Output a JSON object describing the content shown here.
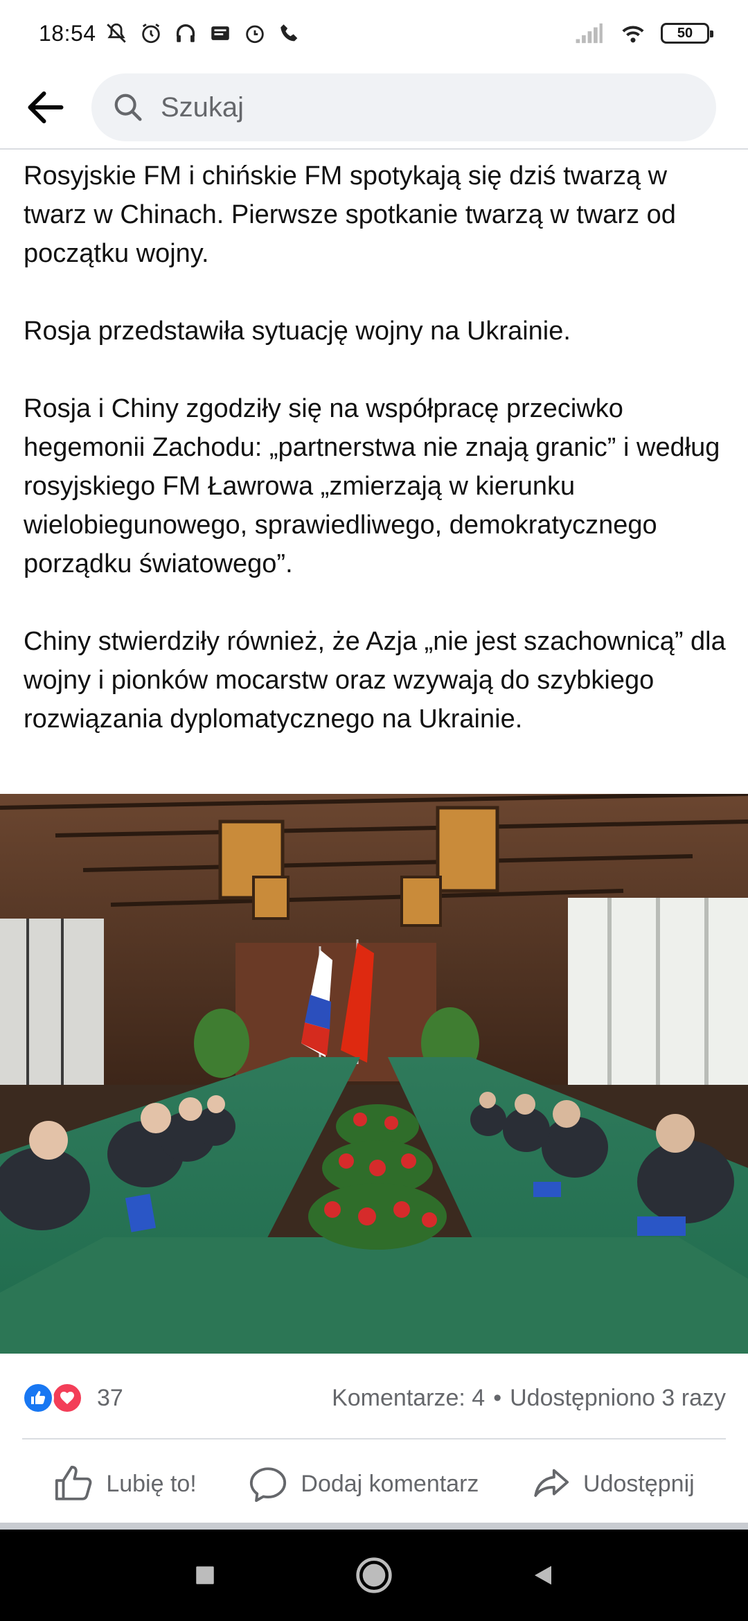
{
  "status_bar": {
    "time": "18:54",
    "battery": "50",
    "left_icons": [
      "mute-icon",
      "alarm-icon",
      "headset-icon",
      "message-icon",
      "alarm-clock-icon",
      "phone-icon"
    ],
    "right_icons": [
      "signal-icon",
      "wifi-icon",
      "battery-icon"
    ]
  },
  "top_nav": {
    "back_icon": "arrow-left-icon",
    "search_placeholder": "Szukaj"
  },
  "post": {
    "paragraphs": [
      "Rosyjskie FM i chińskie FM spotykają się dziś twarzą w twarz w Chinach. Pierwsze spotkanie twarzą w twarz od początku wojny.",
      "Rosja przedstawiła sytuację wojny na Ukrainie.",
      "Rosja i Chiny zgodziły się na współpracę przeciwko hegemonii Zachodu: „partnerstwa nie znają granic” i według rosyjskiego FM Ławrowa „zmierzają w kierunku wielobiegunowego, sprawiedliwego, demokratycznego porządku światowego”.",
      "Chiny stwierdziły również, że Azja „nie jest szachownicą” dla wojny i pionków mocarstw oraz wzywają do szybkiego rozwiązania dyplomatycznego na Ukrainie."
    ]
  },
  "reactions": {
    "count": "37",
    "comments": "Komentarze: 4",
    "separator": "•",
    "shares": "Udostępniono 3 razy"
  },
  "actions": {
    "like_label": "Lubię to!",
    "comment_label": "Dodaj komentarz",
    "share_label": "Udostępnij"
  },
  "colors": {
    "like_blue": "#1877f2",
    "love_red": "#f33e58",
    "secondary_text": "#65676b",
    "search_bg": "#f0f2f5"
  }
}
